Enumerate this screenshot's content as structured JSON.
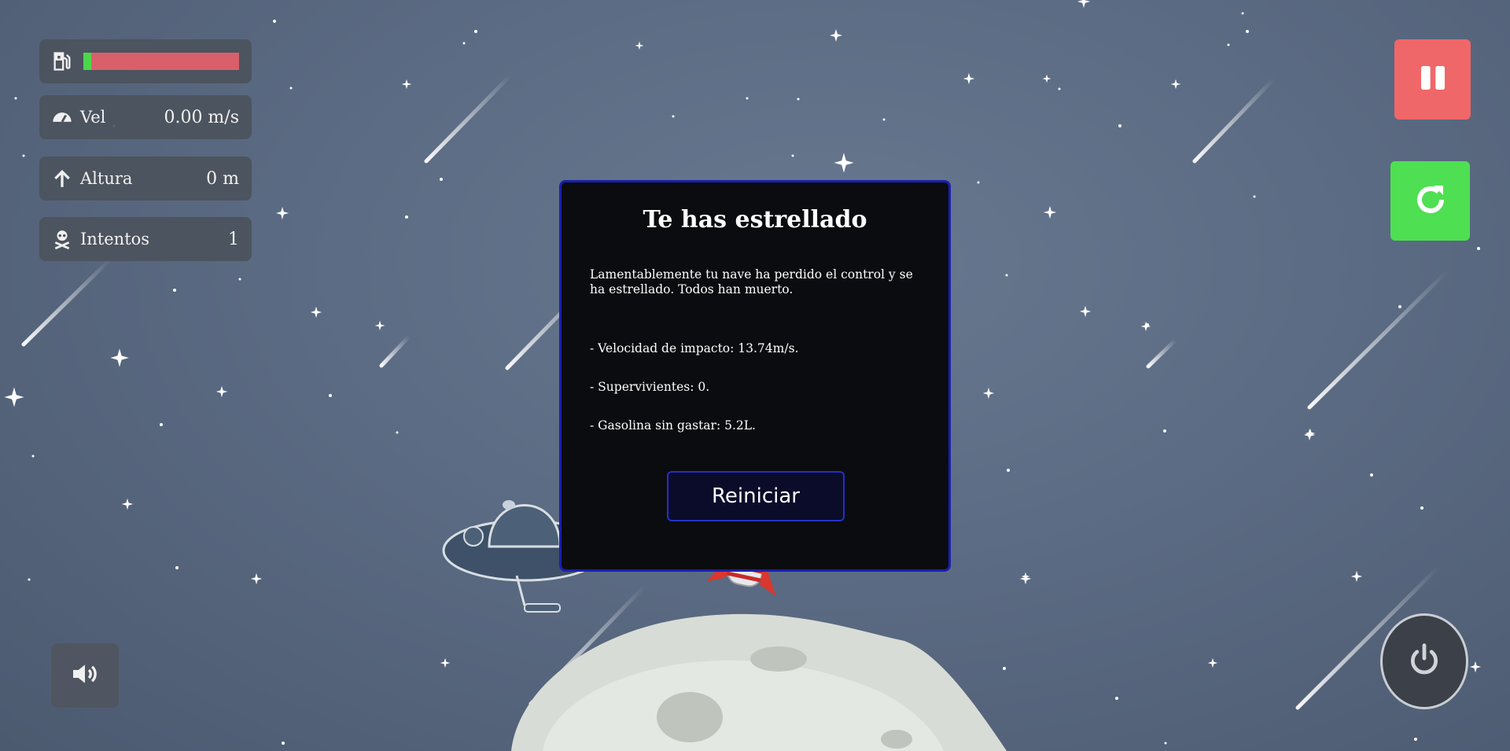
{
  "hud": {
    "fuel": {
      "icon": "fuel-pump-icon",
      "level": 0.05,
      "fill_color": "#4cd64c",
      "empty_color": "#d9606b"
    },
    "velocity": {
      "icon": "speedometer-icon",
      "label": "Vel",
      "value": "0.00 m/s"
    },
    "altitude": {
      "icon": "arrow-up-icon",
      "label": "Altura",
      "value": "0 m"
    },
    "attempts": {
      "icon": "skull-crossbones-icon",
      "label": "Intentos",
      "value": "1"
    }
  },
  "controls": {
    "pause": {
      "icon": "pause-icon",
      "color": "#f06769"
    },
    "restart": {
      "icon": "refresh-icon",
      "color": "#4fdf52"
    },
    "power": {
      "icon": "power-icon"
    },
    "sound": {
      "icon": "speaker-icon"
    }
  },
  "dialog": {
    "title": "Te has estrellado",
    "message": "Lamentablemente tu nave ha perdido el control y se ha estrellado. Todos han muerto.",
    "stats": [
      "- Velocidad de impacto: 13.74m/s.",
      "- Supervivientes: 0.",
      "- Gasolina sin gastar: 5.2L."
    ],
    "restart_label": "Reiniciar",
    "border_color": "#1a1fb0"
  }
}
